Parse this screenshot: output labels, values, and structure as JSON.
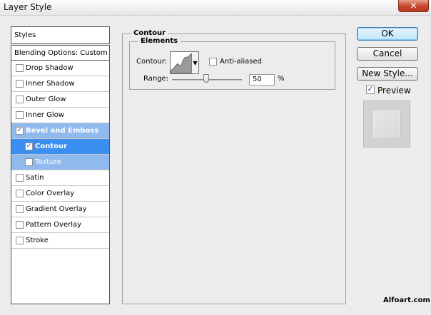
{
  "window": {
    "title": "Layer Style",
    "close_glyph": "✕"
  },
  "styles_header": "Styles",
  "blending_options": "Blending Options: Custom",
  "styles_list": [
    {
      "label": "Drop Shadow",
      "checked": false
    },
    {
      "label": "Inner Shadow",
      "checked": false
    },
    {
      "label": "Outer Glow",
      "checked": false
    },
    {
      "label": "Inner Glow",
      "checked": false
    },
    {
      "label": "Bevel and Emboss",
      "checked": true
    },
    {
      "label": "Contour",
      "checked": true
    },
    {
      "label": "Texture",
      "checked": false
    },
    {
      "label": "Satin",
      "checked": false
    },
    {
      "label": "Color Overlay",
      "checked": false
    },
    {
      "label": "Gradient Overlay",
      "checked": false
    },
    {
      "label": "Pattern Overlay",
      "checked": false
    },
    {
      "label": "Stroke",
      "checked": false
    }
  ],
  "panel": {
    "section_title": "Contour",
    "group_title": "Elements",
    "contour_label": "Contour:",
    "anti_aliased_label": "Anti-aliased",
    "anti_aliased_checked": false,
    "range_label": "Range:",
    "range_value": "50",
    "range_unit": "%",
    "range_fraction": 0.5
  },
  "buttons": {
    "ok": "OK",
    "cancel": "Cancel",
    "new_style": "New Style..."
  },
  "preview": {
    "label": "Preview",
    "checked": true
  },
  "watermark": "Alfoart.com",
  "colors": {
    "selected_light": "#90b9ee",
    "selected_strong": "#3a8ff0",
    "ok_border": "#3c7fb1"
  }
}
